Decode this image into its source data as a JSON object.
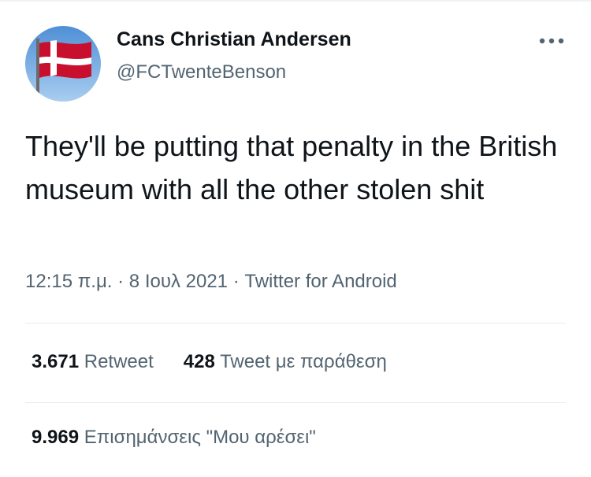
{
  "user": {
    "display_name": "Cans Christian Andersen",
    "handle": "@FCTwenteBenson",
    "avatar_icon": "denmark-flag-icon"
  },
  "tweet": {
    "text": "They'll be putting that penalty in the British museum with all the other stolen shit",
    "time": "12:15 π.μ.",
    "separator": "·",
    "date": "8 Ιουλ 2021",
    "source": "Twitter for Android"
  },
  "stats": {
    "retweets": {
      "count": "3.671",
      "label": "Retweet"
    },
    "quotes": {
      "count": "428",
      "label": "Tweet με παράθεση"
    },
    "likes": {
      "count": "9.969",
      "label": "Επισημάνσεις \"Μου αρέσει\""
    }
  },
  "colors": {
    "text_primary": "#0f1419",
    "text_secondary": "#536471",
    "divider": "#e6ecf0",
    "flag_red": "#c8102e"
  }
}
